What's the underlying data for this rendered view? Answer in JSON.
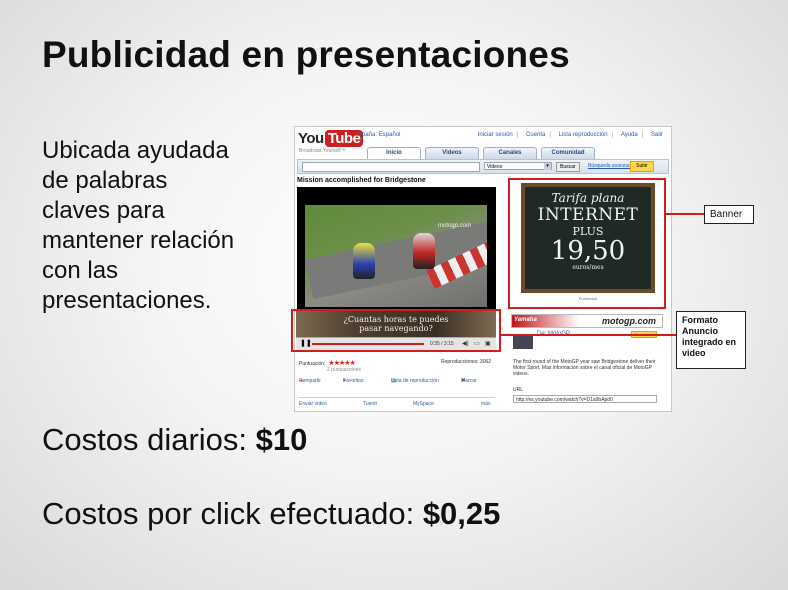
{
  "slide": {
    "title": "Publicidad en presentaciones",
    "description_lines": [
      "Ubicada ayudada",
      "de palabras",
      "claves para",
      "mantener relación",
      "con las",
      "presentaciones."
    ],
    "costs": {
      "daily_label": "Costos diarios:",
      "daily_value": "$10",
      "click_label": "Costos por click efectuado:",
      "click_value": "$0,25"
    }
  },
  "screenshot": {
    "logo": {
      "you": "You",
      "tube": "Tube",
      "slogan": "Broadcast Yourself™"
    },
    "lang_link": "España: Español",
    "top_links": [
      "Iniciar sesión",
      "Cuenta",
      "Lista reproducción",
      "Ayuda",
      "Salir"
    ],
    "tabs": [
      "Inicio",
      "Videos",
      "Canales",
      "Comunidad"
    ],
    "search": {
      "category": "Videos",
      "button_label": "Buscar",
      "advanced_label": "Búsqueda avanzada",
      "upload_label": "Subir"
    },
    "video_title": "Mission accomplished for Bridgestone",
    "player_watermark": "motogp.com",
    "overlay_ad_text": [
      "¿Cuantas horas te puedes",
      "pasar navegando?"
    ],
    "controls": {
      "time": "0:35 / 3:15"
    },
    "rating": {
      "label": "Puntuación:",
      "stars": "★★★★★",
      "sub": "2 puntuaciones",
      "views": "Reproducciones: 3062"
    },
    "actions": [
      "Compartir",
      "Favoritos",
      "Lista de reproducción",
      "Marcar"
    ],
    "shares": [
      "Enviar vídeo",
      "Tuenti",
      "MySpace",
      "más"
    ],
    "banner_ad": {
      "lines": [
        "Tarifa plana",
        "INTERNET",
        "PLUS",
        "19,50",
        "euros/mes"
      ],
      "caption": "Publicidad"
    },
    "side_banner": {
      "left_text": "Yamaha",
      "brand": "motogp.com"
    },
    "channel": {
      "name": "De: MotoGP",
      "subscribe": "Suscribirse",
      "description": "The first round of the MotoGP year saw Bridgestone deliver their Motor Sport. Mas información sobre el canal oficial de MotoGP videos.",
      "url_label": "URL",
      "url": "http://es.youtube.com/watch?v=D1a9bApd0"
    }
  },
  "callouts": {
    "banner": "Banner",
    "overlay": "Formato Anuncio integrado en video"
  },
  "colors": {
    "highlight": "#d51c1c",
    "youtube_red": "#cc1f1f"
  }
}
